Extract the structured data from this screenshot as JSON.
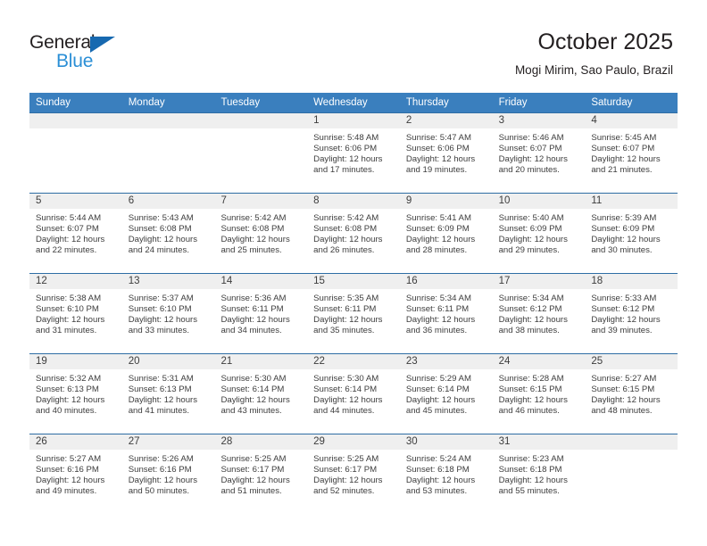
{
  "brand": {
    "name_part1": "General",
    "name_part2": "Blue",
    "triangle_icon": "triangle-flag-icon",
    "color_dark": "#231f20",
    "color_blue": "#2b8fd6"
  },
  "header": {
    "title": "October 2025",
    "subtitle": "Mogi Mirim, Sao Paulo, Brazil"
  },
  "theme": {
    "header_bar": "#3a7fbe",
    "row_divider": "#2e6da4",
    "daynum_band": "#efefef",
    "text": "#3d3d3d"
  },
  "weekdays": [
    "Sunday",
    "Monday",
    "Tuesday",
    "Wednesday",
    "Thursday",
    "Friday",
    "Saturday"
  ],
  "weeks": [
    [
      {
        "day": "",
        "sunrise": "",
        "sunset": "",
        "daylight1": "",
        "daylight2": ""
      },
      {
        "day": "",
        "sunrise": "",
        "sunset": "",
        "daylight1": "",
        "daylight2": ""
      },
      {
        "day": "",
        "sunrise": "",
        "sunset": "",
        "daylight1": "",
        "daylight2": ""
      },
      {
        "day": "1",
        "sunrise": "Sunrise: 5:48 AM",
        "sunset": "Sunset: 6:06 PM",
        "daylight1": "Daylight: 12 hours",
        "daylight2": "and 17 minutes."
      },
      {
        "day": "2",
        "sunrise": "Sunrise: 5:47 AM",
        "sunset": "Sunset: 6:06 PM",
        "daylight1": "Daylight: 12 hours",
        "daylight2": "and 19 minutes."
      },
      {
        "day": "3",
        "sunrise": "Sunrise: 5:46 AM",
        "sunset": "Sunset: 6:07 PM",
        "daylight1": "Daylight: 12 hours",
        "daylight2": "and 20 minutes."
      },
      {
        "day": "4",
        "sunrise": "Sunrise: 5:45 AM",
        "sunset": "Sunset: 6:07 PM",
        "daylight1": "Daylight: 12 hours",
        "daylight2": "and 21 minutes."
      }
    ],
    [
      {
        "day": "5",
        "sunrise": "Sunrise: 5:44 AM",
        "sunset": "Sunset: 6:07 PM",
        "daylight1": "Daylight: 12 hours",
        "daylight2": "and 22 minutes."
      },
      {
        "day": "6",
        "sunrise": "Sunrise: 5:43 AM",
        "sunset": "Sunset: 6:08 PM",
        "daylight1": "Daylight: 12 hours",
        "daylight2": "and 24 minutes."
      },
      {
        "day": "7",
        "sunrise": "Sunrise: 5:42 AM",
        "sunset": "Sunset: 6:08 PM",
        "daylight1": "Daylight: 12 hours",
        "daylight2": "and 25 minutes."
      },
      {
        "day": "8",
        "sunrise": "Sunrise: 5:42 AM",
        "sunset": "Sunset: 6:08 PM",
        "daylight1": "Daylight: 12 hours",
        "daylight2": "and 26 minutes."
      },
      {
        "day": "9",
        "sunrise": "Sunrise: 5:41 AM",
        "sunset": "Sunset: 6:09 PM",
        "daylight1": "Daylight: 12 hours",
        "daylight2": "and 28 minutes."
      },
      {
        "day": "10",
        "sunrise": "Sunrise: 5:40 AM",
        "sunset": "Sunset: 6:09 PM",
        "daylight1": "Daylight: 12 hours",
        "daylight2": "and 29 minutes."
      },
      {
        "day": "11",
        "sunrise": "Sunrise: 5:39 AM",
        "sunset": "Sunset: 6:09 PM",
        "daylight1": "Daylight: 12 hours",
        "daylight2": "and 30 minutes."
      }
    ],
    [
      {
        "day": "12",
        "sunrise": "Sunrise: 5:38 AM",
        "sunset": "Sunset: 6:10 PM",
        "daylight1": "Daylight: 12 hours",
        "daylight2": "and 31 minutes."
      },
      {
        "day": "13",
        "sunrise": "Sunrise: 5:37 AM",
        "sunset": "Sunset: 6:10 PM",
        "daylight1": "Daylight: 12 hours",
        "daylight2": "and 33 minutes."
      },
      {
        "day": "14",
        "sunrise": "Sunrise: 5:36 AM",
        "sunset": "Sunset: 6:11 PM",
        "daylight1": "Daylight: 12 hours",
        "daylight2": "and 34 minutes."
      },
      {
        "day": "15",
        "sunrise": "Sunrise: 5:35 AM",
        "sunset": "Sunset: 6:11 PM",
        "daylight1": "Daylight: 12 hours",
        "daylight2": "and 35 minutes."
      },
      {
        "day": "16",
        "sunrise": "Sunrise: 5:34 AM",
        "sunset": "Sunset: 6:11 PM",
        "daylight1": "Daylight: 12 hours",
        "daylight2": "and 36 minutes."
      },
      {
        "day": "17",
        "sunrise": "Sunrise: 5:34 AM",
        "sunset": "Sunset: 6:12 PM",
        "daylight1": "Daylight: 12 hours",
        "daylight2": "and 38 minutes."
      },
      {
        "day": "18",
        "sunrise": "Sunrise: 5:33 AM",
        "sunset": "Sunset: 6:12 PM",
        "daylight1": "Daylight: 12 hours",
        "daylight2": "and 39 minutes."
      }
    ],
    [
      {
        "day": "19",
        "sunrise": "Sunrise: 5:32 AM",
        "sunset": "Sunset: 6:13 PM",
        "daylight1": "Daylight: 12 hours",
        "daylight2": "and 40 minutes."
      },
      {
        "day": "20",
        "sunrise": "Sunrise: 5:31 AM",
        "sunset": "Sunset: 6:13 PM",
        "daylight1": "Daylight: 12 hours",
        "daylight2": "and 41 minutes."
      },
      {
        "day": "21",
        "sunrise": "Sunrise: 5:30 AM",
        "sunset": "Sunset: 6:14 PM",
        "daylight1": "Daylight: 12 hours",
        "daylight2": "and 43 minutes."
      },
      {
        "day": "22",
        "sunrise": "Sunrise: 5:30 AM",
        "sunset": "Sunset: 6:14 PM",
        "daylight1": "Daylight: 12 hours",
        "daylight2": "and 44 minutes."
      },
      {
        "day": "23",
        "sunrise": "Sunrise: 5:29 AM",
        "sunset": "Sunset: 6:14 PM",
        "daylight1": "Daylight: 12 hours",
        "daylight2": "and 45 minutes."
      },
      {
        "day": "24",
        "sunrise": "Sunrise: 5:28 AM",
        "sunset": "Sunset: 6:15 PM",
        "daylight1": "Daylight: 12 hours",
        "daylight2": "and 46 minutes."
      },
      {
        "day": "25",
        "sunrise": "Sunrise: 5:27 AM",
        "sunset": "Sunset: 6:15 PM",
        "daylight1": "Daylight: 12 hours",
        "daylight2": "and 48 minutes."
      }
    ],
    [
      {
        "day": "26",
        "sunrise": "Sunrise: 5:27 AM",
        "sunset": "Sunset: 6:16 PM",
        "daylight1": "Daylight: 12 hours",
        "daylight2": "and 49 minutes."
      },
      {
        "day": "27",
        "sunrise": "Sunrise: 5:26 AM",
        "sunset": "Sunset: 6:16 PM",
        "daylight1": "Daylight: 12 hours",
        "daylight2": "and 50 minutes."
      },
      {
        "day": "28",
        "sunrise": "Sunrise: 5:25 AM",
        "sunset": "Sunset: 6:17 PM",
        "daylight1": "Daylight: 12 hours",
        "daylight2": "and 51 minutes."
      },
      {
        "day": "29",
        "sunrise": "Sunrise: 5:25 AM",
        "sunset": "Sunset: 6:17 PM",
        "daylight1": "Daylight: 12 hours",
        "daylight2": "and 52 minutes."
      },
      {
        "day": "30",
        "sunrise": "Sunrise: 5:24 AM",
        "sunset": "Sunset: 6:18 PM",
        "daylight1": "Daylight: 12 hours",
        "daylight2": "and 53 minutes."
      },
      {
        "day": "31",
        "sunrise": "Sunrise: 5:23 AM",
        "sunset": "Sunset: 6:18 PM",
        "daylight1": "Daylight: 12 hours",
        "daylight2": "and 55 minutes."
      },
      {
        "day": "",
        "sunrise": "",
        "sunset": "",
        "daylight1": "",
        "daylight2": ""
      }
    ]
  ]
}
